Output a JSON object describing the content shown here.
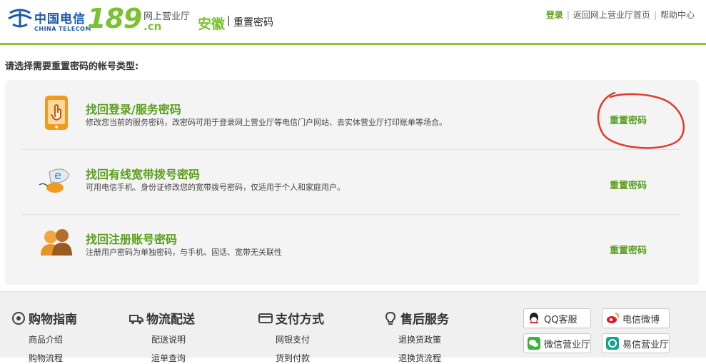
{
  "header": {
    "logo_cn": "中国电信",
    "logo_en": "CHINA TELECOM",
    "logo_189": "189",
    "logo_suffix": ".cn",
    "logo_hall": "网上营业厅",
    "province": "安徽",
    "separator": "|",
    "page_name": "重置密码",
    "links": {
      "login": "登录",
      "home": "返回网上营业厅首页",
      "help": "帮助中心",
      "sep": "|"
    }
  },
  "intro": "请选择需要重置密码的帐号类型:",
  "options": [
    {
      "title": "找回登录/服务密码",
      "desc": "修改您当前的服务密码，改密码可用于登录网上营业厅等电信门户网站、去实体营业厅打印账单等场合。",
      "action": "重置密码",
      "icon": "phone-touch-icon"
    },
    {
      "title": "找回有线宽带拨号密码",
      "desc": "可用电信手机、身份证修改您的宽带拨号密码，仅适用于个人和家庭用户。",
      "action": "重置密码",
      "icon": "broadband-mouse-icon"
    },
    {
      "title": "找回注册账号密码",
      "desc": "注册用户密码为单独密码，与手机、固话、宽带无关联性",
      "action": "重置密码",
      "icon": "users-icon"
    }
  ],
  "annotation": {
    "color": "#e23a2a"
  },
  "footer": {
    "columns": [
      {
        "title": "购物指南",
        "icon": "info-circle-icon",
        "items": [
          "商品介绍",
          "购物流程"
        ]
      },
      {
        "title": "物流配送",
        "icon": "truck-icon",
        "items": [
          "配送说明",
          "运单查询"
        ]
      },
      {
        "title": "支付方式",
        "icon": "card-icon",
        "items": [
          "网银支付",
          "货到付款"
        ]
      },
      {
        "title": "售后服务",
        "icon": "bulb-icon",
        "items": [
          "退换货政策",
          "退换货流程"
        ]
      }
    ],
    "social": [
      {
        "label": "QQ客服",
        "icon": "qq-icon"
      },
      {
        "label": "电信微博",
        "icon": "weibo-icon"
      },
      {
        "label": "微信营业厅",
        "icon": "wechat-icon"
      },
      {
        "label": "易信营业厅",
        "icon": "yixin-icon"
      }
    ]
  },
  "colors": {
    "accent": "#5a9e1c",
    "header_line": "#8cc43c",
    "logo_blue": "#1a5aa8"
  }
}
